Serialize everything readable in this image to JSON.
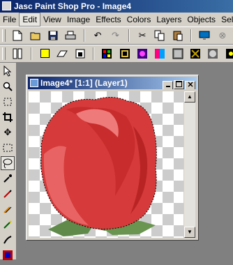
{
  "app": {
    "title": "Jasc Paint Shop Pro - Image4"
  },
  "menu": {
    "items": [
      "File",
      "Edit",
      "View",
      "Image",
      "Effects",
      "Colors",
      "Layers",
      "Objects",
      "Sele"
    ]
  },
  "toolbar1": {
    "icons": [
      "new-icon",
      "open-icon",
      "save-icon",
      "print-icon",
      "undo-icon",
      "redo-icon",
      "cut-icon",
      "copy-icon",
      "paste-icon",
      "full-screen-icon",
      "browse-icon",
      "zoom-icon",
      "help-icon"
    ]
  },
  "toolbar2": {
    "icons": [
      "tool-palette-icon",
      "foreground-color-icon",
      "eraser-icon",
      "histogram-icon",
      "layer-palette-icon",
      "frame-icon",
      "effects-icon",
      "colors-icon",
      "tile-icon",
      "mask-icon",
      "flip-icon",
      "sparkle-icon",
      "object-icon",
      "mirror-icon"
    ],
    "colors": {
      "yellow": "#ffff00",
      "blue": "#0000ff",
      "red": "#cc0000",
      "green": "#008000"
    }
  },
  "tools": {
    "icons": [
      "arrow-tool-icon",
      "zoom-tool-icon",
      "deformation-tool-icon",
      "crop-tool-icon",
      "mover-tool-icon",
      "selection-tool-icon",
      "freehand-selection-tool-icon",
      "dropper-tool-icon",
      "paint-brush-tool-icon",
      "clone-brush-tool-icon",
      "color-replacer-tool-icon",
      "retouch-tool-icon",
      "scratch-remover-tool-icon"
    ]
  },
  "document": {
    "title": "Image4* [1:1] (Layer1)",
    "controls": [
      "minimize-button",
      "maximize-button",
      "close-button"
    ]
  },
  "colors": {
    "desktop": "#808080",
    "title_active": "#0a246a",
    "title_fade": "#a6caf0",
    "rose": "#d93a3a"
  }
}
